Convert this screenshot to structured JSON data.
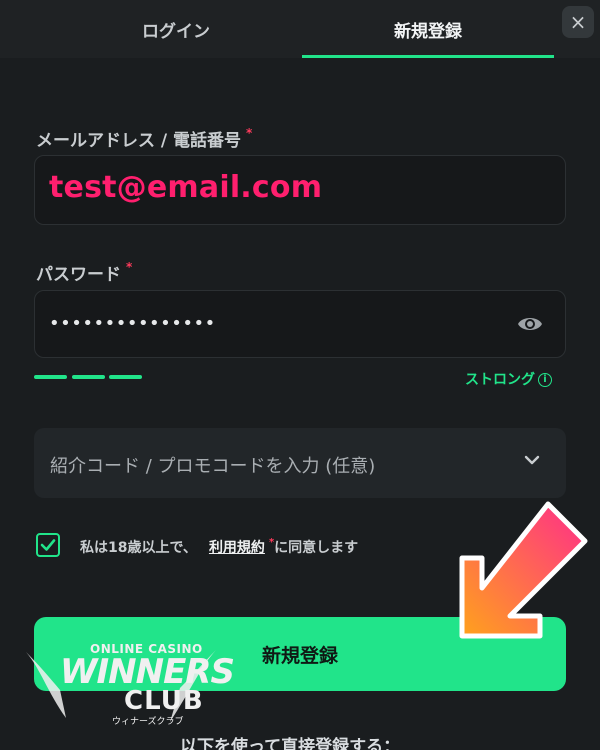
{
  "tabs": {
    "login": "ログイン",
    "register": "新規登録"
  },
  "close_glyph": "×",
  "email": {
    "label": "メールアドレス / 電話番号",
    "required_mark": "*",
    "value": "test@email.com"
  },
  "password": {
    "label": "パスワード",
    "required_mark": "*",
    "value": "•••••••••••••••",
    "toggle_icon": "eye-icon"
  },
  "strength": {
    "label": "ストロング",
    "info_glyph": "i",
    "segments_filled": 3
  },
  "promo": {
    "label": "紹介コード / プロモコードを入力 (任意)",
    "expanded": false
  },
  "agreement": {
    "checked": true,
    "prefix": "私は18歳以上で、",
    "terms_link": "利用規約",
    "required_mark": "*",
    "suffix": "に同意します"
  },
  "submit_label": "新規登録",
  "footer_text": "以下を使って直接登録する：",
  "watermark": {
    "line1": "ONLINE CASINO",
    "line2": "WINNERS",
    "line3": "CLUB",
    "line4": "ウィナーズクラブ"
  },
  "colors": {
    "accent": "#21e48a",
    "required": "#ff3b5c",
    "email_text": "#ff1f6e",
    "background": "#1a1d1f"
  }
}
